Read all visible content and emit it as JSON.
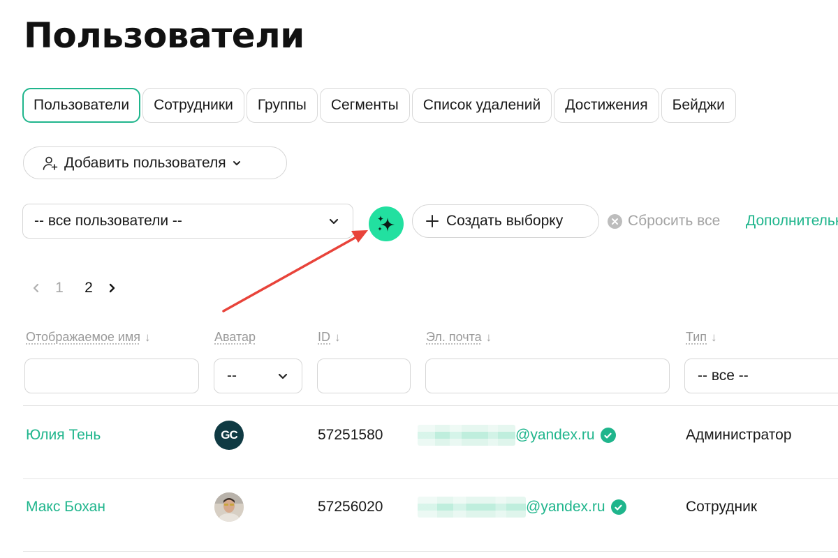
{
  "page": {
    "title": "Пользователи"
  },
  "tabs": [
    {
      "label": "Пользователи",
      "active": true
    },
    {
      "label": "Сотрудники"
    },
    {
      "label": "Группы"
    },
    {
      "label": "Сегменты"
    },
    {
      "label": "Список удалений"
    },
    {
      "label": "Достижения"
    },
    {
      "label": "Бейджи"
    }
  ],
  "actions": {
    "add_user_label": "Добавить пользователя"
  },
  "filters": {
    "audience_select": "-- все пользователи --",
    "create_selection_label": "Создать выборку",
    "reset_all_label": "Сбросить все",
    "more_label": "Дополнительно"
  },
  "pagination": {
    "pages": [
      "1",
      "2"
    ],
    "current": "2"
  },
  "table": {
    "columns": [
      {
        "label": "Отображаемое имя",
        "sort": "↓"
      },
      {
        "label": "Аватар"
      },
      {
        "label": "ID",
        "sort": "↓"
      },
      {
        "label": "Эл. почта",
        "sort": "↓"
      },
      {
        "label": "Тип",
        "sort": "↓"
      }
    ],
    "column_filters": {
      "avatar_select": "--",
      "type_select": "-- все --"
    },
    "rows": [
      {
        "name": "Юлия Тень",
        "avatar_initials": "GC",
        "id": "57251580",
        "email_domain": "@yandex.ru",
        "type": "Администратор"
      },
      {
        "name": "Макс Бохан",
        "id": "57256020",
        "email_domain": "@yandex.ru",
        "type": "Сотрудник"
      }
    ]
  },
  "colors": {
    "accent": "#1fb58c",
    "ai_button": "#22e0a0",
    "annotation_arrow": "#e8433a"
  },
  "icons": {
    "add_user": "user-plus-icon",
    "ai": "sparkles-icon",
    "create": "plus-icon",
    "reset": "close-circle-icon",
    "verified": "check-circle-icon"
  }
}
